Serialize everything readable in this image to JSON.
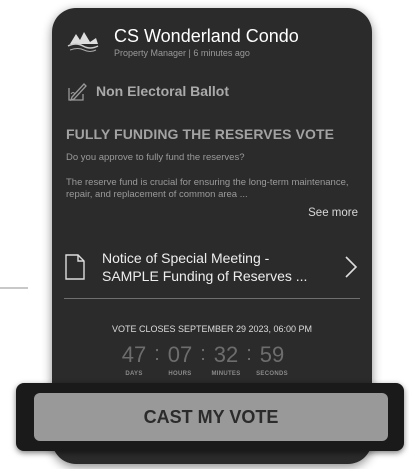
{
  "header": {
    "title": "CS Wonderland Condo",
    "subtitle": "Property Manager | 6 minutes ago"
  },
  "ballot": {
    "label": "Non Electoral Ballot"
  },
  "vote": {
    "title": "FULLY FUNDING THE RESERVES VOTE",
    "question": "Do you approve to fully fund the reserves?",
    "description": "The reserve fund is crucial for ensuring the long-term maintenance, repair, and replacement of common area ...",
    "see_more": "See more"
  },
  "notice": {
    "line1": "Notice of Special Meeting -",
    "line2": "SAMPLE Funding of Reserves ..."
  },
  "closing": {
    "label": "VOTE CLOSES SEPTEMBER 29 2023, 06:00 PM",
    "days": "47",
    "hours": "07",
    "minutes": "32",
    "seconds": "59",
    "days_label": "DAYS",
    "hours_label": "HOURS",
    "minutes_label": "MINUTES",
    "seconds_label": "SECONDS"
  },
  "cast_vote": {
    "label": "CAST MY VOTE"
  },
  "icons": {
    "logo": "condo-logo-icon",
    "ballot": "ballot-pen-icon",
    "document": "document-icon",
    "chevron": "chevron-right-icon"
  }
}
